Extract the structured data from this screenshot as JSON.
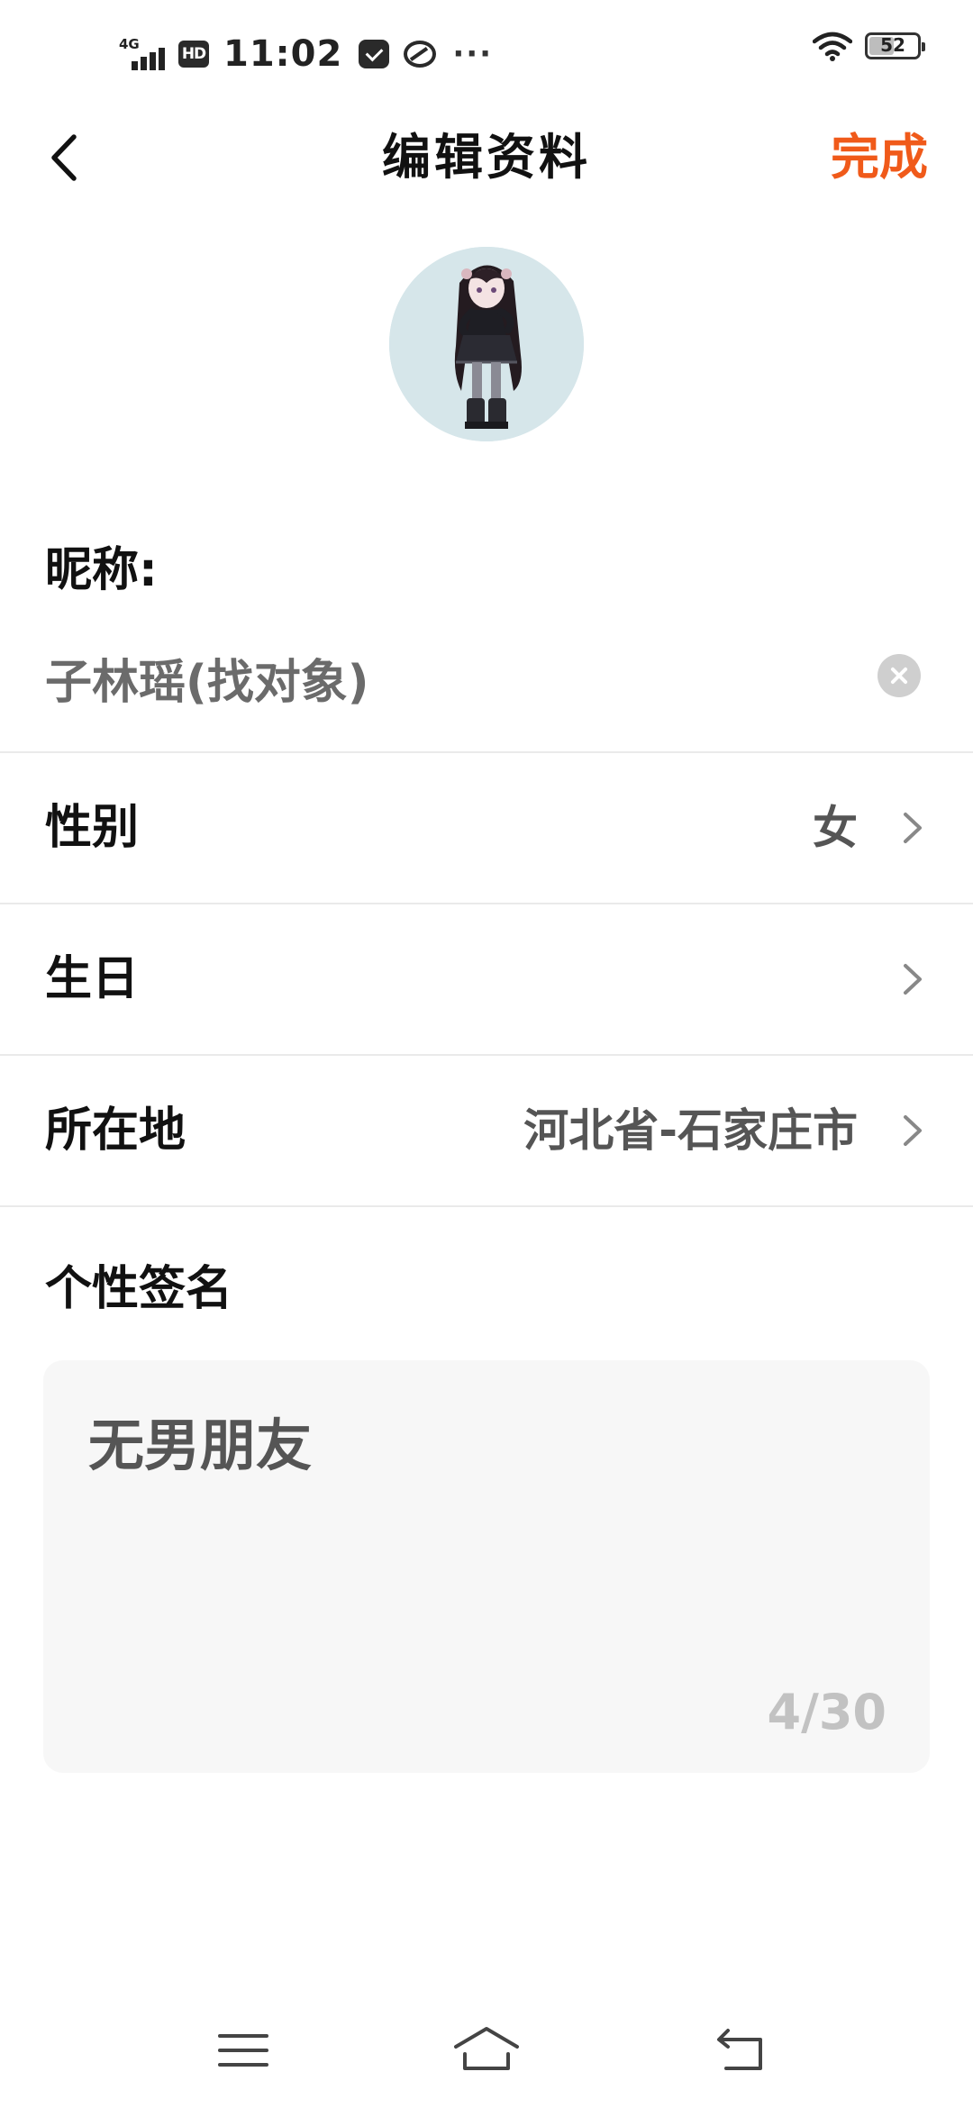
{
  "status_bar": {
    "network": "4G",
    "hd": "HD",
    "time": "11:02",
    "more": "···",
    "battery_level": 52,
    "battery_label": "52"
  },
  "header": {
    "title": "编辑资料",
    "done_label": "完成"
  },
  "colors": {
    "accent": "#f05a1a",
    "text_primary": "#111111",
    "text_secondary": "#555555",
    "divider": "#eaeaea",
    "signature_bg": "#f7f7f7"
  },
  "nickname": {
    "label": "昵称:",
    "value": "子林瑶(找对象)"
  },
  "rows": [
    {
      "label": "性别",
      "value": "女",
      "icon": "chevron-right-icon"
    },
    {
      "label": "生日",
      "value": "",
      "icon": "chevron-right-icon"
    },
    {
      "label": "所在地",
      "value": "河北省-石家庄市",
      "icon": "chevron-right-icon"
    }
  ],
  "signature": {
    "label": "个性签名",
    "text": "无男朋友",
    "counter": "4/30"
  },
  "nav_bar": {
    "icons": [
      "menu-icon",
      "home-icon",
      "back-icon"
    ]
  }
}
